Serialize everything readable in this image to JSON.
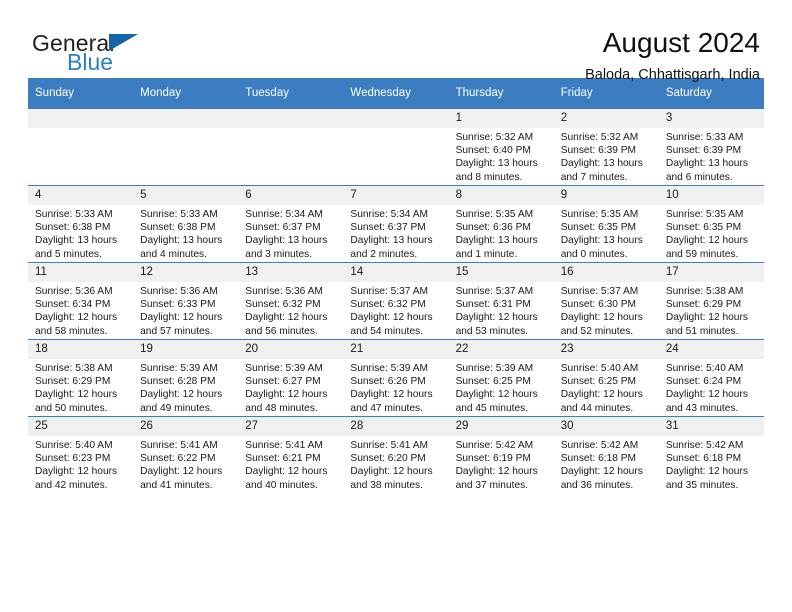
{
  "brand": {
    "name_part1": "General",
    "name_part2": "Blue",
    "triangle_color": "#1565a8",
    "blue_text_color": "#2b7fc3"
  },
  "header": {
    "title": "August 2024",
    "location": "Baloda, Chhattisgarh, India"
  },
  "theme": {
    "header_row_bg": "#3b7dc0",
    "daynum_bg": "#f0f0f0",
    "grid_line": "#3b7dc0"
  },
  "weekday_headers": [
    "Sunday",
    "Monday",
    "Tuesday",
    "Wednesday",
    "Thursday",
    "Friday",
    "Saturday"
  ],
  "weeks": [
    [
      {
        "day": "",
        "sunrise": "",
        "sunset": "",
        "daylight1": "",
        "daylight2": ""
      },
      {
        "day": "",
        "sunrise": "",
        "sunset": "",
        "daylight1": "",
        "daylight2": ""
      },
      {
        "day": "",
        "sunrise": "",
        "sunset": "",
        "daylight1": "",
        "daylight2": ""
      },
      {
        "day": "",
        "sunrise": "",
        "sunset": "",
        "daylight1": "",
        "daylight2": ""
      },
      {
        "day": "1",
        "sunrise": "Sunrise: 5:32 AM",
        "sunset": "Sunset: 6:40 PM",
        "daylight1": "Daylight: 13 hours",
        "daylight2": "and 8 minutes."
      },
      {
        "day": "2",
        "sunrise": "Sunrise: 5:32 AM",
        "sunset": "Sunset: 6:39 PM",
        "daylight1": "Daylight: 13 hours",
        "daylight2": "and 7 minutes."
      },
      {
        "day": "3",
        "sunrise": "Sunrise: 5:33 AM",
        "sunset": "Sunset: 6:39 PM",
        "daylight1": "Daylight: 13 hours",
        "daylight2": "and 6 minutes."
      }
    ],
    [
      {
        "day": "4",
        "sunrise": "Sunrise: 5:33 AM",
        "sunset": "Sunset: 6:38 PM",
        "daylight1": "Daylight: 13 hours",
        "daylight2": "and 5 minutes."
      },
      {
        "day": "5",
        "sunrise": "Sunrise: 5:33 AM",
        "sunset": "Sunset: 6:38 PM",
        "daylight1": "Daylight: 13 hours",
        "daylight2": "and 4 minutes."
      },
      {
        "day": "6",
        "sunrise": "Sunrise: 5:34 AM",
        "sunset": "Sunset: 6:37 PM",
        "daylight1": "Daylight: 13 hours",
        "daylight2": "and 3 minutes."
      },
      {
        "day": "7",
        "sunrise": "Sunrise: 5:34 AM",
        "sunset": "Sunset: 6:37 PM",
        "daylight1": "Daylight: 13 hours",
        "daylight2": "and 2 minutes."
      },
      {
        "day": "8",
        "sunrise": "Sunrise: 5:35 AM",
        "sunset": "Sunset: 6:36 PM",
        "daylight1": "Daylight: 13 hours",
        "daylight2": "and 1 minute."
      },
      {
        "day": "9",
        "sunrise": "Sunrise: 5:35 AM",
        "sunset": "Sunset: 6:35 PM",
        "daylight1": "Daylight: 13 hours",
        "daylight2": "and 0 minutes."
      },
      {
        "day": "10",
        "sunrise": "Sunrise: 5:35 AM",
        "sunset": "Sunset: 6:35 PM",
        "daylight1": "Daylight: 12 hours",
        "daylight2": "and 59 minutes."
      }
    ],
    [
      {
        "day": "11",
        "sunrise": "Sunrise: 5:36 AM",
        "sunset": "Sunset: 6:34 PM",
        "daylight1": "Daylight: 12 hours",
        "daylight2": "and 58 minutes."
      },
      {
        "day": "12",
        "sunrise": "Sunrise: 5:36 AM",
        "sunset": "Sunset: 6:33 PM",
        "daylight1": "Daylight: 12 hours",
        "daylight2": "and 57 minutes."
      },
      {
        "day": "13",
        "sunrise": "Sunrise: 5:36 AM",
        "sunset": "Sunset: 6:32 PM",
        "daylight1": "Daylight: 12 hours",
        "daylight2": "and 56 minutes."
      },
      {
        "day": "14",
        "sunrise": "Sunrise: 5:37 AM",
        "sunset": "Sunset: 6:32 PM",
        "daylight1": "Daylight: 12 hours",
        "daylight2": "and 54 minutes."
      },
      {
        "day": "15",
        "sunrise": "Sunrise: 5:37 AM",
        "sunset": "Sunset: 6:31 PM",
        "daylight1": "Daylight: 12 hours",
        "daylight2": "and 53 minutes."
      },
      {
        "day": "16",
        "sunrise": "Sunrise: 5:37 AM",
        "sunset": "Sunset: 6:30 PM",
        "daylight1": "Daylight: 12 hours",
        "daylight2": "and 52 minutes."
      },
      {
        "day": "17",
        "sunrise": "Sunrise: 5:38 AM",
        "sunset": "Sunset: 6:29 PM",
        "daylight1": "Daylight: 12 hours",
        "daylight2": "and 51 minutes."
      }
    ],
    [
      {
        "day": "18",
        "sunrise": "Sunrise: 5:38 AM",
        "sunset": "Sunset: 6:29 PM",
        "daylight1": "Daylight: 12 hours",
        "daylight2": "and 50 minutes."
      },
      {
        "day": "19",
        "sunrise": "Sunrise: 5:39 AM",
        "sunset": "Sunset: 6:28 PM",
        "daylight1": "Daylight: 12 hours",
        "daylight2": "and 49 minutes."
      },
      {
        "day": "20",
        "sunrise": "Sunrise: 5:39 AM",
        "sunset": "Sunset: 6:27 PM",
        "daylight1": "Daylight: 12 hours",
        "daylight2": "and 48 minutes."
      },
      {
        "day": "21",
        "sunrise": "Sunrise: 5:39 AM",
        "sunset": "Sunset: 6:26 PM",
        "daylight1": "Daylight: 12 hours",
        "daylight2": "and 47 minutes."
      },
      {
        "day": "22",
        "sunrise": "Sunrise: 5:39 AM",
        "sunset": "Sunset: 6:25 PM",
        "daylight1": "Daylight: 12 hours",
        "daylight2": "and 45 minutes."
      },
      {
        "day": "23",
        "sunrise": "Sunrise: 5:40 AM",
        "sunset": "Sunset: 6:25 PM",
        "daylight1": "Daylight: 12 hours",
        "daylight2": "and 44 minutes."
      },
      {
        "day": "24",
        "sunrise": "Sunrise: 5:40 AM",
        "sunset": "Sunset: 6:24 PM",
        "daylight1": "Daylight: 12 hours",
        "daylight2": "and 43 minutes."
      }
    ],
    [
      {
        "day": "25",
        "sunrise": "Sunrise: 5:40 AM",
        "sunset": "Sunset: 6:23 PM",
        "daylight1": "Daylight: 12 hours",
        "daylight2": "and 42 minutes."
      },
      {
        "day": "26",
        "sunrise": "Sunrise: 5:41 AM",
        "sunset": "Sunset: 6:22 PM",
        "daylight1": "Daylight: 12 hours",
        "daylight2": "and 41 minutes."
      },
      {
        "day": "27",
        "sunrise": "Sunrise: 5:41 AM",
        "sunset": "Sunset: 6:21 PM",
        "daylight1": "Daylight: 12 hours",
        "daylight2": "and 40 minutes."
      },
      {
        "day": "28",
        "sunrise": "Sunrise: 5:41 AM",
        "sunset": "Sunset: 6:20 PM",
        "daylight1": "Daylight: 12 hours",
        "daylight2": "and 38 minutes."
      },
      {
        "day": "29",
        "sunrise": "Sunrise: 5:42 AM",
        "sunset": "Sunset: 6:19 PM",
        "daylight1": "Daylight: 12 hours",
        "daylight2": "and 37 minutes."
      },
      {
        "day": "30",
        "sunrise": "Sunrise: 5:42 AM",
        "sunset": "Sunset: 6:18 PM",
        "daylight1": "Daylight: 12 hours",
        "daylight2": "and 36 minutes."
      },
      {
        "day": "31",
        "sunrise": "Sunrise: 5:42 AM",
        "sunset": "Sunset: 6:18 PM",
        "daylight1": "Daylight: 12 hours",
        "daylight2": "and 35 minutes."
      }
    ]
  ]
}
